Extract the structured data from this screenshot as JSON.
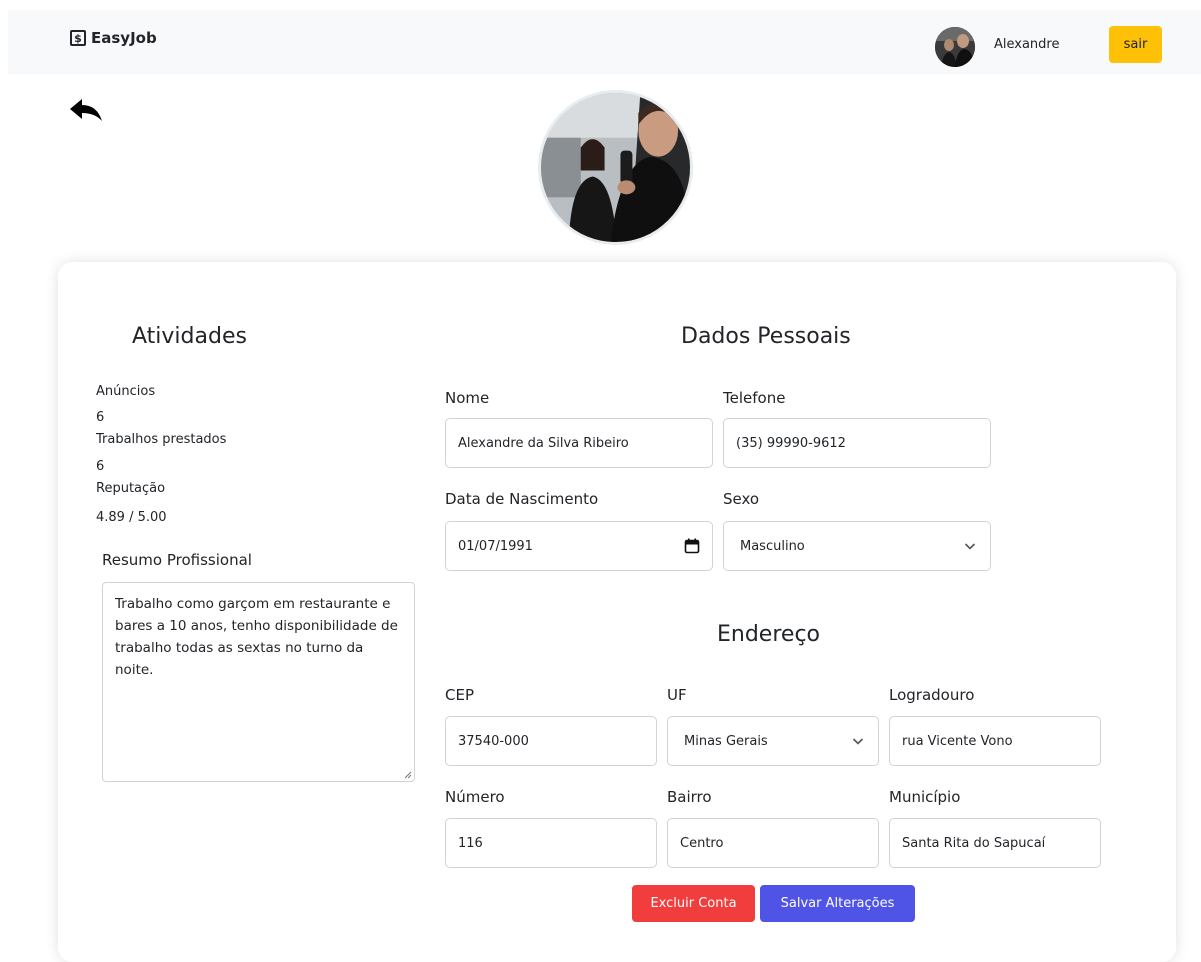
{
  "navbar": {
    "brand_symbol": "$",
    "brand": "EasyJob",
    "user_name": "Alexandre",
    "logout_label": "sair"
  },
  "activities": {
    "title": "Atividades",
    "ads_label": "Anúncios",
    "ads_value": "6",
    "jobs_label": "Trabalhos prestados",
    "jobs_value": "6",
    "reputation_label": "Reputação",
    "reputation_value": "4.89 / 5.00",
    "summary_label": "Resumo Profissional",
    "summary_text": "Trabalho como garçom em restaurante e bares a 10 anos, tenho disponibilidade de trabalho todas as sextas no turno da noite."
  },
  "personal": {
    "title": "Dados Pessoais",
    "name_label": "Nome",
    "name_value": "Alexandre da Silva Ribeiro",
    "phone_label": "Telefone",
    "phone_value": "(35) 99990-9612",
    "birth_label": "Data de Nascimento",
    "birth_value": "01/07/1991",
    "sex_label": "Sexo",
    "sex_value": "Masculino"
  },
  "address": {
    "title": "Endereço",
    "cep_label": "CEP",
    "cep_value": "37540-000",
    "uf_label": "UF",
    "uf_value": "Minas Gerais",
    "street_label": "Logradouro",
    "street_value": "rua Vicente Vono",
    "number_label": "Número",
    "number_value": "116",
    "district_label": "Bairro",
    "district_value": "Centro",
    "city_label": "Município",
    "city_value": "Santa Rita do Sapucaí"
  },
  "actions": {
    "delete_label": "Excluir Conta",
    "save_label": "Salvar Alterações"
  },
  "colors": {
    "navbar_bg": "#f8f9fa",
    "logout_bg": "#ffc107",
    "delete_bg": "#f23d3d",
    "save_bg": "#4f53e6"
  }
}
